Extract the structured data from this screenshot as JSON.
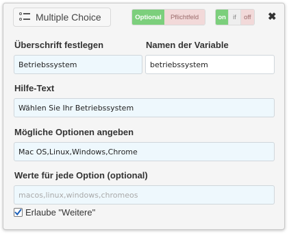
{
  "header": {
    "type_label": "Multiple Choice",
    "requirement": {
      "optional": "Optional",
      "required": "Pflichtfeld",
      "selected": "optional"
    },
    "visibility": {
      "on": "on",
      "if": "if",
      "off": "off",
      "selected": "on"
    },
    "close_symbol": "✖"
  },
  "fields": {
    "heading": {
      "label": "Überschrift festlegen",
      "value": "Betriebssystem"
    },
    "variable": {
      "label": "Namen der Variable",
      "value": "betriebssystem"
    },
    "help": {
      "label": "Hilfe-Text",
      "value": "Wählen Sie Ihr Betriebssystem"
    },
    "options": {
      "label": "Mögliche Optionen angeben",
      "value": "Mac OS,Linux,Windows,Chrome"
    },
    "values": {
      "label": "Werte für jede Option (optional)",
      "placeholder": "macos,linux,windows,chromeos"
    }
  },
  "allow_other": {
    "label": "Erlaube \"Weitere\"",
    "checked": true
  },
  "colors": {
    "green": "#7ccf7c",
    "pink": "#f2d9d9",
    "input_bg": "#eef8fd"
  }
}
